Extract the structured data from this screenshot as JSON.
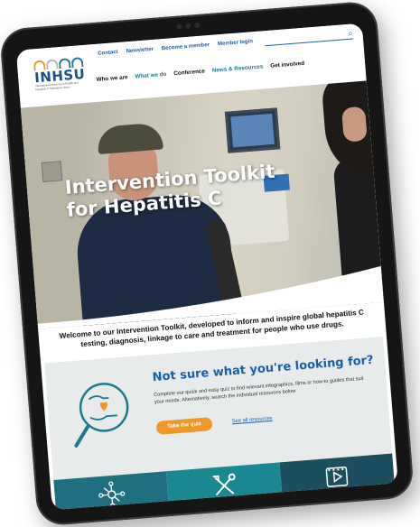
{
  "logo": {
    "word": "INHSU",
    "subtitle": "International Network on Health and Hepatitis in Substance Users",
    "arch_colors": [
      "#e89a2b",
      "#b8b8b8",
      "#1a7b8c",
      "#2a6fb0"
    ]
  },
  "utility_nav": {
    "items": [
      {
        "label": "Contact"
      },
      {
        "label": "Newsletter"
      },
      {
        "label": "Become a member"
      },
      {
        "label": "Member login"
      }
    ],
    "search_icon": "search-icon"
  },
  "main_nav": {
    "items": [
      {
        "label": "Who we are"
      },
      {
        "label": "What we do"
      },
      {
        "label": "Conference"
      },
      {
        "label": "News & Resources"
      },
      {
        "label": "Get involved"
      }
    ]
  },
  "hero": {
    "title_line1": "Intervention Toolkit",
    "title_line2": "for Hepatitis C"
  },
  "welcome": {
    "text": "Welcome to our Intervention Toolkit, developed to inform and inspire global hepatitis C testing, diagnosis, linkage to care and treatment for people who use drugs."
  },
  "quiz": {
    "title": "Not sure what you're looking for?",
    "text": "Complete our quick and easy quiz to find relevant infographics, films or how-to guides that suit your needs. Alternatively, search the individual resources below",
    "button_label": "Take the quiz",
    "link_label": "See all resources",
    "icon": "magnifier-hands-heart-icon"
  },
  "tiles": [
    {
      "icon": "network-icon"
    },
    {
      "icon": "tools-icon"
    },
    {
      "icon": "film-icon"
    }
  ],
  "colors": {
    "brand_blue": "#1a5ea8",
    "teal": "#1a7b8c",
    "orange": "#f0972a",
    "quiz_bg": "#e8ebec"
  }
}
